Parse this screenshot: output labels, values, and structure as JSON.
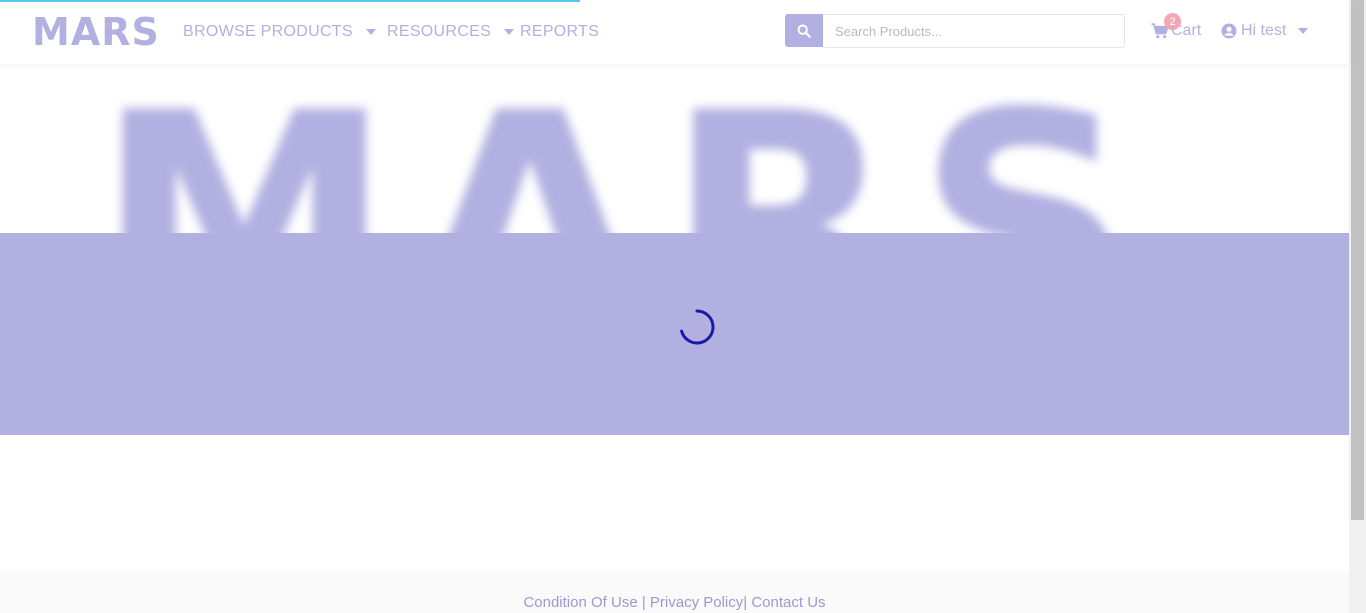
{
  "brand": {
    "logo_text": "MARS",
    "hero_text": "MARS",
    "accent": "#b1b0e1",
    "spinner_color": "#1a1aa8"
  },
  "progress": {
    "fraction": 0.43
  },
  "nav": {
    "browse_products": "BROWSE PRODUCTS",
    "resources": "RESOURCES",
    "reports": "REPORTS"
  },
  "search": {
    "placeholder": "Search Products..."
  },
  "cart": {
    "label": "Cart",
    "count": "2"
  },
  "user": {
    "greeting": "Hi test"
  },
  "footer": {
    "condition": "Condition Of Use",
    "sep1": " | ",
    "privacy": "Privacy Policy",
    "sep2": "| ",
    "contact": "Contact Us"
  },
  "icons": [
    "search-icon",
    "cart-icon",
    "user-circle-icon",
    "chevron-down-icon",
    "loading-spinner-icon"
  ]
}
